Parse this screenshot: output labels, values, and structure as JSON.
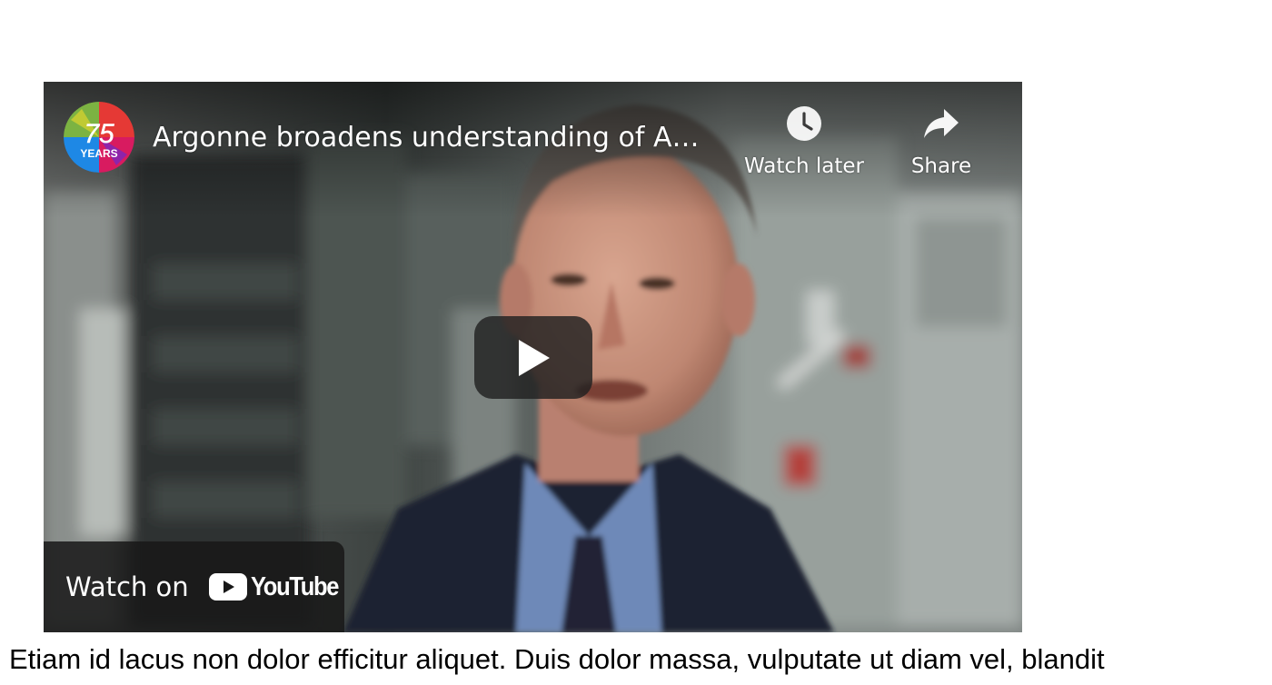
{
  "video": {
    "title": "Argonne broadens understanding of A…",
    "channel": {
      "avatar_number": "75",
      "avatar_text": "YEARS"
    },
    "actions": {
      "watch_later_label": "Watch later",
      "share_label": "Share"
    },
    "watch_on": {
      "label": "Watch on",
      "brand": "YouTube"
    },
    "icons": {
      "watch_later": "clock-icon",
      "share": "share-arrow-icon",
      "play": "play-icon",
      "youtube": "youtube-logo-icon"
    },
    "colors": {
      "youtube_red": "#ff0000",
      "overlay_dark": "#171717"
    }
  },
  "article": {
    "paragraph": "Etiam id lacus non dolor efficitur aliquet. Duis dolor massa, vulputate ut diam vel, blandit"
  }
}
